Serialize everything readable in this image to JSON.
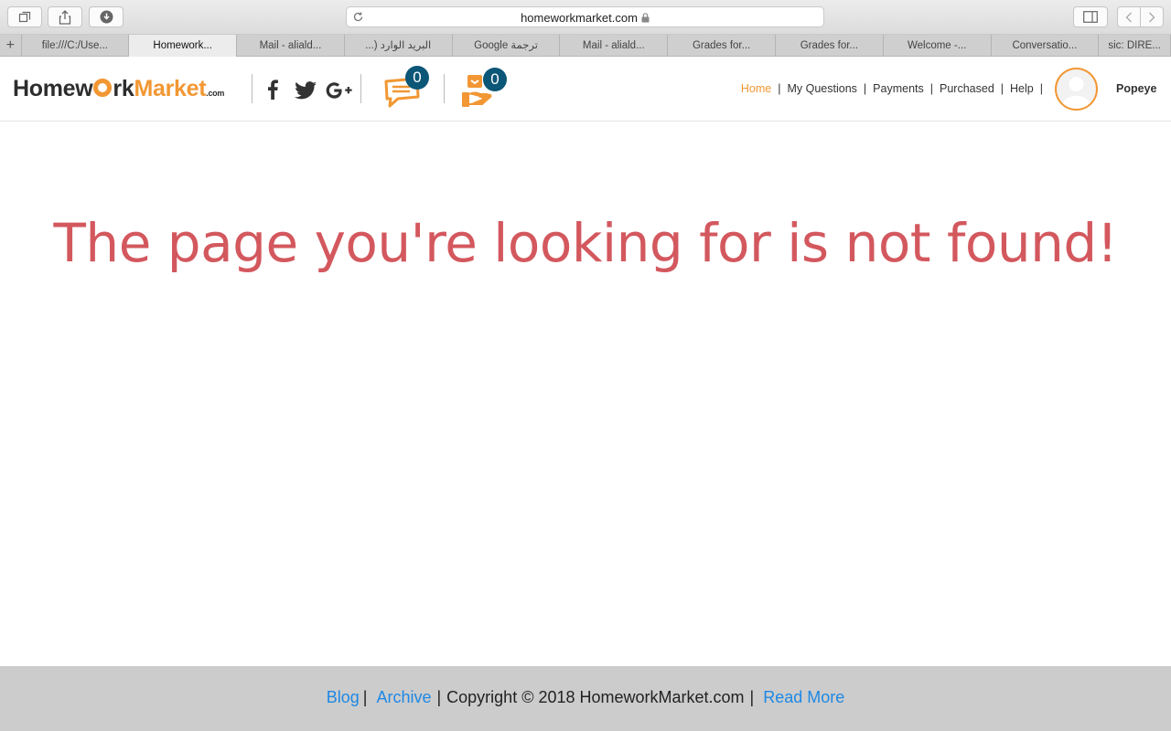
{
  "browser": {
    "url": "homeworkmarket.com",
    "tabs": [
      {
        "label": "file:///C:/Use...",
        "active": false
      },
      {
        "label": "Homework...",
        "active": true
      },
      {
        "label": "Mail - aliald...",
        "active": false
      },
      {
        "label": "البريد الوارد (...",
        "active": false
      },
      {
        "label": "Google ترجمة",
        "active": false
      },
      {
        "label": "Mail - aliald...",
        "active": false
      },
      {
        "label": "Grades for...",
        "active": false
      },
      {
        "label": "Grades for...",
        "active": false
      },
      {
        "label": "Welcome -...",
        "active": false
      },
      {
        "label": "Conversatio...",
        "active": false
      },
      {
        "label": "sic: DIRE...",
        "active": false
      }
    ]
  },
  "header": {
    "logo": {
      "part1": "Homew",
      "part2": "rk",
      "part3": "Market",
      "suffix": ".com"
    },
    "social_icons": [
      "facebook-icon",
      "twitter-icon",
      "google-plus-icon"
    ],
    "messages_count": "0",
    "notifications_count": "0",
    "nav": [
      {
        "label": "Home",
        "active": true
      },
      {
        "label": "My Questions",
        "active": false
      },
      {
        "label": "Payments",
        "active": false
      },
      {
        "label": "Purchased",
        "active": false
      },
      {
        "label": "Help",
        "active": false
      }
    ],
    "username": "Popeye"
  },
  "main": {
    "message": "The page you're looking for is not found!"
  },
  "footer": {
    "blog": "Blog",
    "archive": "Archive",
    "copyright": "Copyright © 2018 HomeworkMarket.com",
    "read_more": "Read More"
  },
  "colors": {
    "brand_orange": "#f29733",
    "error_red": "#d3585e",
    "badge_blue": "#0c5677",
    "link_blue": "#1e88e5",
    "footer_bg": "#cccccc"
  }
}
